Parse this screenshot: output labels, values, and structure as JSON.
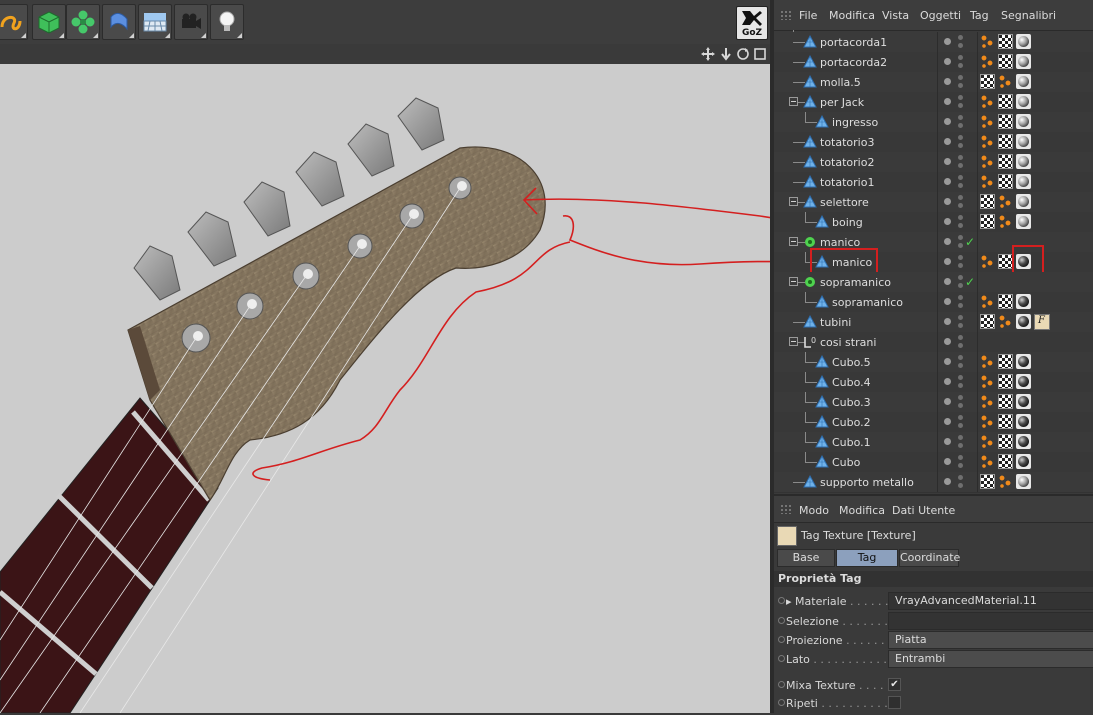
{
  "toolbar": {
    "buttons": [
      {
        "name": "spline-tool-icon"
      },
      {
        "name": "cube-object-icon"
      },
      {
        "name": "cloner-icon"
      },
      {
        "name": "deformer-icon"
      },
      {
        "name": "floor-icon"
      },
      {
        "name": "camera-icon"
      },
      {
        "name": "light-icon"
      }
    ],
    "goz_label": "GoZ"
  },
  "object_manager": {
    "menu": [
      "File",
      "Modifica",
      "Vista",
      "Oggetti",
      "Tag",
      "Segnalibri"
    ],
    "rows": [
      {
        "name": "portacorda1",
        "depth": 1,
        "tags": [
          "phong",
          "uvw",
          "mat"
        ]
      },
      {
        "name": "portacorda2",
        "depth": 1,
        "tags": [
          "phong",
          "uvw",
          "mat"
        ]
      },
      {
        "name": "molla.5",
        "depth": 1,
        "tags": [
          "uvw",
          "phong",
          "mat"
        ]
      },
      {
        "name": "per Jack",
        "depth": 1,
        "expanded": true,
        "tags": [
          "phong",
          "uvw",
          "mat"
        ]
      },
      {
        "name": "ingresso",
        "depth": 2,
        "tags": [
          "phong",
          "uvw",
          "mat"
        ]
      },
      {
        "name": "totatorio3",
        "depth": 1,
        "tags": [
          "phong",
          "uvw",
          "mat"
        ]
      },
      {
        "name": "totatorio2",
        "depth": 1,
        "tags": [
          "phong",
          "uvw",
          "mat"
        ]
      },
      {
        "name": "totatorio1",
        "depth": 1,
        "tags": [
          "phong",
          "uvw",
          "mat"
        ]
      },
      {
        "name": "selettore",
        "depth": 1,
        "expanded": true,
        "tags": [
          "uvw",
          "phong",
          "mat"
        ]
      },
      {
        "name": "boing",
        "depth": 2,
        "tags": [
          "uvw",
          "phong",
          "mat"
        ]
      },
      {
        "name": "manico",
        "depth": 1,
        "expanded": true,
        "generator": true,
        "check": true,
        "tags": []
      },
      {
        "name": "manico",
        "depth": 2,
        "tags": [
          "phong",
          "uvw",
          "mat-dark"
        ],
        "highlight": true
      },
      {
        "name": "sopramanico",
        "depth": 1,
        "expanded": true,
        "generator": true,
        "check": true,
        "tags": []
      },
      {
        "name": "sopramanico",
        "depth": 2,
        "tags": [
          "phong",
          "uvw",
          "mat-dark"
        ]
      },
      {
        "name": "tubini",
        "depth": 1,
        "tags": [
          "uvw",
          "phong",
          "mat-dark",
          "tex"
        ]
      },
      {
        "name": "cosi strani",
        "depth": 1,
        "expanded": true,
        "null": true,
        "tags": []
      },
      {
        "name": "Cubo.5",
        "depth": 2,
        "tags": [
          "phong",
          "uvw",
          "mat-dark"
        ]
      },
      {
        "name": "Cubo.4",
        "depth": 2,
        "tags": [
          "phong",
          "uvw",
          "mat-dark"
        ]
      },
      {
        "name": "Cubo.3",
        "depth": 2,
        "tags": [
          "phong",
          "uvw",
          "mat-dark"
        ]
      },
      {
        "name": "Cubo.2",
        "depth": 2,
        "tags": [
          "phong",
          "uvw",
          "mat-dark"
        ]
      },
      {
        "name": "Cubo.1",
        "depth": 2,
        "tags": [
          "phong",
          "uvw",
          "mat-dark"
        ]
      },
      {
        "name": "Cubo",
        "depth": 2,
        "tags": [
          "phong",
          "uvw",
          "mat-dark"
        ]
      },
      {
        "name": "supporto metallo",
        "depth": 1,
        "tags": [
          "uvw",
          "phong",
          "mat"
        ]
      }
    ]
  },
  "attribute_manager": {
    "menu": [
      "Modo",
      "Modifica",
      "Dati Utente"
    ],
    "title": "Tag Texture [Texture]",
    "tabs": [
      "Base",
      "Tag",
      "Coordinate"
    ],
    "active_tab": "Tag",
    "section": "Proprietà Tag",
    "props": [
      {
        "label": "Materiale",
        "dots": " . . . . . .",
        "value": "VrayAdvancedMaterial.11",
        "kind": "field-dark",
        "arrow": true
      },
      {
        "label": "Selezione",
        "dots": " . . . . . . . .",
        "value": "",
        "kind": "field-dark"
      },
      {
        "label": "Proiezione",
        "dots": " . . . . . . .",
        "value": "Piatta",
        "kind": "field"
      },
      {
        "label": "Lato",
        "dots": " . . . . . . . . . . . .",
        "value": "Entrambi",
        "kind": "field"
      },
      {
        "label": "Mixa Texture",
        "dots": " . . . . .",
        "value": "✔",
        "kind": "check"
      },
      {
        "label": "Ripeti",
        "dots": " . . . . . . . . . . .",
        "value": "",
        "kind": "check"
      }
    ]
  },
  "colors": {
    "annotation_red": "#d41f1f",
    "active_tab": "#8ca0bd",
    "phong_orange": "#f08a1a",
    "generator_green": "#4fd34f"
  }
}
